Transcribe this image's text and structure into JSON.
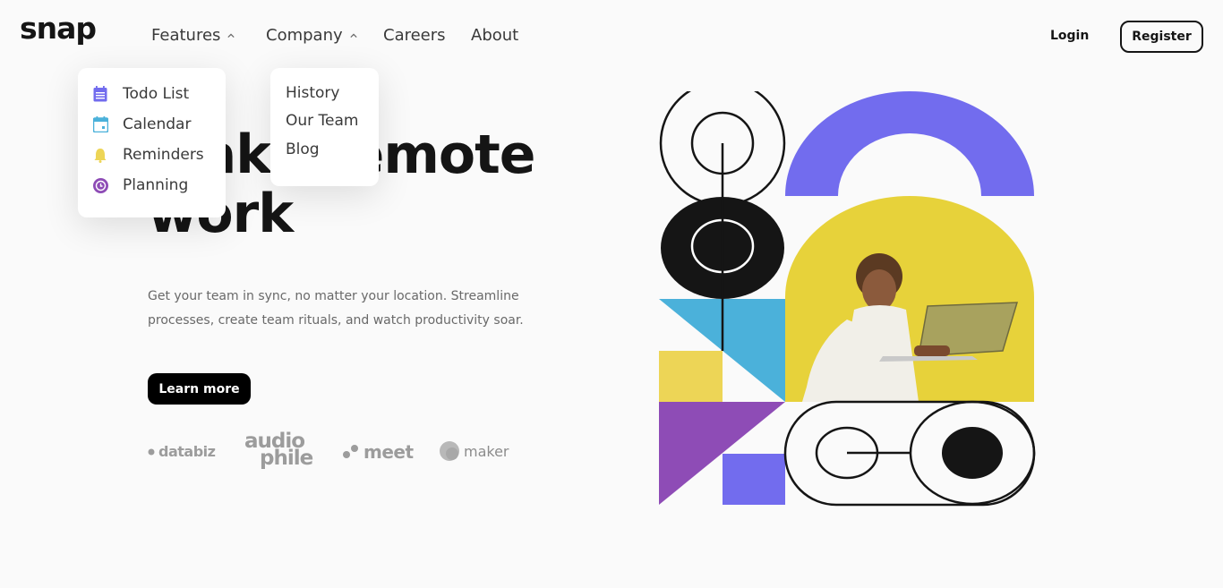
{
  "header": {
    "logo": "snap",
    "nav": [
      {
        "label": "Features"
      },
      {
        "label": "Company"
      },
      {
        "label": "Careers"
      },
      {
        "label": "About"
      }
    ],
    "login_label": "Login",
    "register_label": "Register"
  },
  "features_dropdown": {
    "items": [
      {
        "label": "Todo List",
        "icon": "todo-icon",
        "color": "#726cee"
      },
      {
        "label": "Calendar",
        "icon": "calendar-icon",
        "color": "#4bb1da"
      },
      {
        "label": "Reminders",
        "icon": "bell-icon",
        "color": "#edd556"
      },
      {
        "label": "Planning",
        "icon": "clock-icon",
        "color": "#8e4cb6"
      }
    ]
  },
  "company_dropdown": {
    "items": [
      {
        "label": "History"
      },
      {
        "label": "Our Team"
      },
      {
        "label": "Blog"
      }
    ]
  },
  "hero": {
    "title_line1": "Make remote",
    "title_line2": "work",
    "text_line1": "Get your team in sync, no matter your location. Streamline",
    "text_line2": "processes, create team rituals, and watch productivity soar.",
    "cta_label": "Learn more"
  },
  "clients": {
    "databiz": "databiz",
    "audiophile_line1": "audio",
    "audiophile_line2": "phile",
    "meet": "meet",
    "maker": "maker"
  },
  "colors": {
    "background": "#fafafa",
    "text": "#151515",
    "muted": "#696969",
    "purple": "#726cee",
    "blue": "#4bb1da",
    "yellow": "#edd556",
    "violet": "#8e4cb6"
  }
}
